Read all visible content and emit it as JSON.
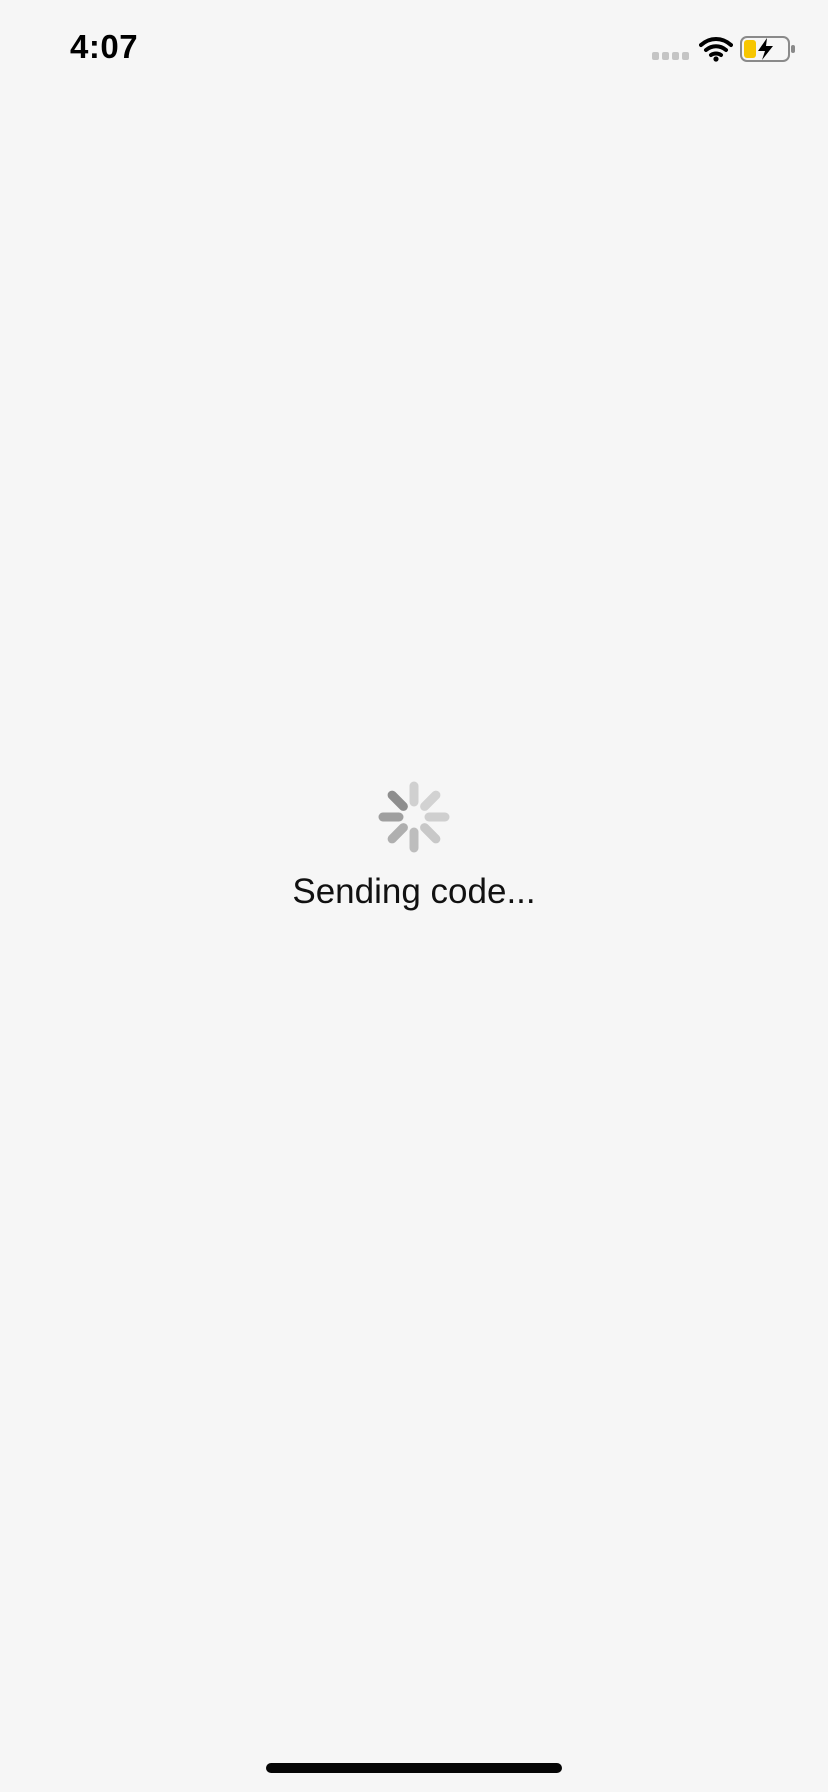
{
  "status_bar": {
    "time": "4:07",
    "cellular_icon": "no-signal-dots-icon",
    "wifi_icon": "wifi-icon",
    "battery_icon": "battery-charging-icon",
    "battery_color": "#f7c600"
  },
  "loading": {
    "spinner_icon": "activity-spinner-icon",
    "message": "Sending code..."
  },
  "colors": {
    "background": "#f6f6f6",
    "home_indicator": "#050505"
  }
}
